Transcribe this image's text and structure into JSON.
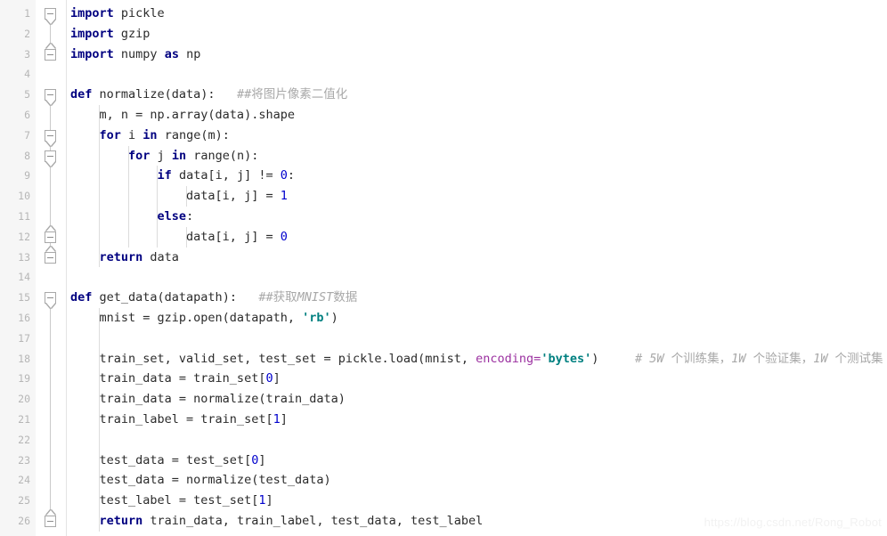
{
  "editor": {
    "language": "python",
    "total_lines": 26,
    "colors": {
      "background": "#ffffff",
      "gutter_background": "#f6f6f6",
      "line_number": "#b6b6b6",
      "keyword": "#000080",
      "string": "#008080",
      "number": "#0000cd",
      "named_parameter": "#9b30a0",
      "comment": "#a8a8a8",
      "text": "#2b2b2b",
      "indent_guide": "#dcdcdc"
    }
  },
  "line_numbers": [
    "1",
    "2",
    "3",
    "4",
    "5",
    "6",
    "7",
    "8",
    "9",
    "10",
    "11",
    "12",
    "13",
    "14",
    "15",
    "16",
    "17",
    "18",
    "19",
    "20",
    "21",
    "22",
    "23",
    "24",
    "25",
    "26"
  ],
  "lines": [
    {
      "number": "1",
      "fold": "start",
      "tokens": [
        {
          "t": "kw",
          "s": "import"
        },
        {
          "t": "plain",
          "s": " pickle"
        }
      ]
    },
    {
      "number": "2",
      "fold": "none",
      "tokens": [
        {
          "t": "kw",
          "s": "import"
        },
        {
          "t": "plain",
          "s": " gzip"
        }
      ]
    },
    {
      "number": "3",
      "fold": "end",
      "tokens": [
        {
          "t": "kw",
          "s": "import"
        },
        {
          "t": "plain",
          "s": " numpy "
        },
        {
          "t": "kw",
          "s": "as"
        },
        {
          "t": "plain",
          "s": " np"
        }
      ]
    },
    {
      "number": "4",
      "fold": "none",
      "tokens": []
    },
    {
      "number": "5",
      "fold": "start",
      "tokens": [
        {
          "t": "kw",
          "s": "def"
        },
        {
          "t": "plain",
          "s": " normalize(data):   "
        },
        {
          "t": "com",
          "s": "##将图片像素二值化"
        }
      ]
    },
    {
      "number": "6",
      "fold": "none",
      "tokens": [
        {
          "t": "plain",
          "s": "    m, n = np.array(data).shape"
        }
      ]
    },
    {
      "number": "7",
      "fold": "start",
      "tokens": [
        {
          "t": "plain",
          "s": "    "
        },
        {
          "t": "kw",
          "s": "for"
        },
        {
          "t": "plain",
          "s": " i "
        },
        {
          "t": "kw",
          "s": "in"
        },
        {
          "t": "plain",
          "s": " range(m):"
        }
      ]
    },
    {
      "number": "8",
      "fold": "start",
      "tokens": [
        {
          "t": "plain",
          "s": "        "
        },
        {
          "t": "kw",
          "s": "for"
        },
        {
          "t": "plain",
          "s": " j "
        },
        {
          "t": "kw",
          "s": "in"
        },
        {
          "t": "plain",
          "s": " range(n):"
        }
      ]
    },
    {
      "number": "9",
      "fold": "none",
      "tokens": [
        {
          "t": "plain",
          "s": "            "
        },
        {
          "t": "kw",
          "s": "if"
        },
        {
          "t": "plain",
          "s": " data[i, j] != "
        },
        {
          "t": "num",
          "s": "0"
        },
        {
          "t": "plain",
          "s": ":"
        }
      ]
    },
    {
      "number": "10",
      "fold": "none",
      "tokens": [
        {
          "t": "plain",
          "s": "                data[i, j] = "
        },
        {
          "t": "num",
          "s": "1"
        }
      ]
    },
    {
      "number": "11",
      "fold": "none",
      "tokens": [
        {
          "t": "plain",
          "s": "            "
        },
        {
          "t": "kw",
          "s": "else"
        },
        {
          "t": "plain",
          "s": ":"
        }
      ]
    },
    {
      "number": "12",
      "fold": "end",
      "tokens": [
        {
          "t": "plain",
          "s": "                data[i, j] = "
        },
        {
          "t": "num",
          "s": "0"
        }
      ]
    },
    {
      "number": "13",
      "fold": "end",
      "tokens": [
        {
          "t": "plain",
          "s": "    "
        },
        {
          "t": "kw",
          "s": "return"
        },
        {
          "t": "plain",
          "s": " data"
        }
      ]
    },
    {
      "number": "14",
      "fold": "none",
      "tokens": []
    },
    {
      "number": "15",
      "fold": "start",
      "tokens": [
        {
          "t": "kw",
          "s": "def"
        },
        {
          "t": "plain",
          "s": " get_data(datapath):   "
        },
        {
          "t": "com",
          "s": "##获取"
        },
        {
          "t": "com-i",
          "s": "MNIST"
        },
        {
          "t": "com",
          "s": "数据"
        }
      ]
    },
    {
      "number": "16",
      "fold": "none",
      "tokens": [
        {
          "t": "plain",
          "s": "    mnist = gzip.open(datapath, "
        },
        {
          "t": "str",
          "s": "'rb'"
        },
        {
          "t": "plain",
          "s": ")"
        }
      ]
    },
    {
      "number": "17",
      "fold": "none",
      "tokens": []
    },
    {
      "number": "18",
      "fold": "none",
      "tokens": [
        {
          "t": "plain",
          "s": "    train_set, valid_set, test_set = pickle.load(mnist, "
        },
        {
          "t": "param",
          "s": "encoding="
        },
        {
          "t": "str",
          "s": "'bytes'"
        },
        {
          "t": "plain",
          "s": ")     "
        },
        {
          "t": "com",
          "s": "# "
        },
        {
          "t": "com-i",
          "s": "5W"
        },
        {
          "t": "com",
          "s": " 个训练集，"
        },
        {
          "t": "com-i",
          "s": "1W"
        },
        {
          "t": "com",
          "s": " 个验证集，"
        },
        {
          "t": "com-i",
          "s": "1W"
        },
        {
          "t": "com",
          "s": " 个测试集"
        }
      ]
    },
    {
      "number": "19",
      "fold": "none",
      "tokens": [
        {
          "t": "plain",
          "s": "    train_data = train_set["
        },
        {
          "t": "num",
          "s": "0"
        },
        {
          "t": "plain",
          "s": "]"
        }
      ]
    },
    {
      "number": "20",
      "fold": "none",
      "tokens": [
        {
          "t": "plain",
          "s": "    train_data = normalize(train_data)"
        }
      ]
    },
    {
      "number": "21",
      "fold": "none",
      "tokens": [
        {
          "t": "plain",
          "s": "    train_label = train_set["
        },
        {
          "t": "num",
          "s": "1"
        },
        {
          "t": "plain",
          "s": "]"
        }
      ]
    },
    {
      "number": "22",
      "fold": "none",
      "tokens": []
    },
    {
      "number": "23",
      "fold": "none",
      "tokens": [
        {
          "t": "plain",
          "s": "    test_data = test_set["
        },
        {
          "t": "num",
          "s": "0"
        },
        {
          "t": "plain",
          "s": "]"
        }
      ]
    },
    {
      "number": "24",
      "fold": "none",
      "tokens": [
        {
          "t": "plain",
          "s": "    test_data = normalize(test_data)"
        }
      ]
    },
    {
      "number": "25",
      "fold": "none",
      "tokens": [
        {
          "t": "plain",
          "s": "    test_label = test_set["
        },
        {
          "t": "num",
          "s": "1"
        },
        {
          "t": "plain",
          "s": "]"
        }
      ]
    },
    {
      "number": "26",
      "fold": "end",
      "tokens": [
        {
          "t": "plain",
          "s": "    "
        },
        {
          "t": "kw",
          "s": "return"
        },
        {
          "t": "plain",
          "s": " train_data, train_label, test_data, test_label"
        }
      ]
    }
  ],
  "fold_markers": [
    {
      "line": 1,
      "kind": "start"
    },
    {
      "line": 3,
      "kind": "end"
    },
    {
      "line": 5,
      "kind": "start"
    },
    {
      "line": 7,
      "kind": "start"
    },
    {
      "line": 8,
      "kind": "start"
    },
    {
      "line": 12,
      "kind": "end"
    },
    {
      "line": 13,
      "kind": "end"
    },
    {
      "line": 15,
      "kind": "start"
    },
    {
      "line": 26,
      "kind": "end"
    }
  ],
  "fold_rails": [
    {
      "from_line": 1,
      "to_line": 3
    },
    {
      "from_line": 5,
      "to_line": 13
    },
    {
      "from_line": 7,
      "to_line": 12
    },
    {
      "from_line": 8,
      "to_line": 12
    },
    {
      "from_line": 15,
      "to_line": 26
    }
  ],
  "indent_guides": [
    {
      "indent": 1,
      "from_line": 6,
      "to_line": 13
    },
    {
      "indent": 2,
      "from_line": 8,
      "to_line": 12
    },
    {
      "indent": 3,
      "from_line": 9,
      "to_line": 12
    },
    {
      "indent": 4,
      "from_line": 10,
      "to_line": 10
    },
    {
      "indent": 4,
      "from_line": 12,
      "to_line": 12
    },
    {
      "indent": 1,
      "from_line": 16,
      "to_line": 26
    }
  ],
  "watermark": {
    "text": "https://blog.csdn.net/Rong_Robot"
  }
}
